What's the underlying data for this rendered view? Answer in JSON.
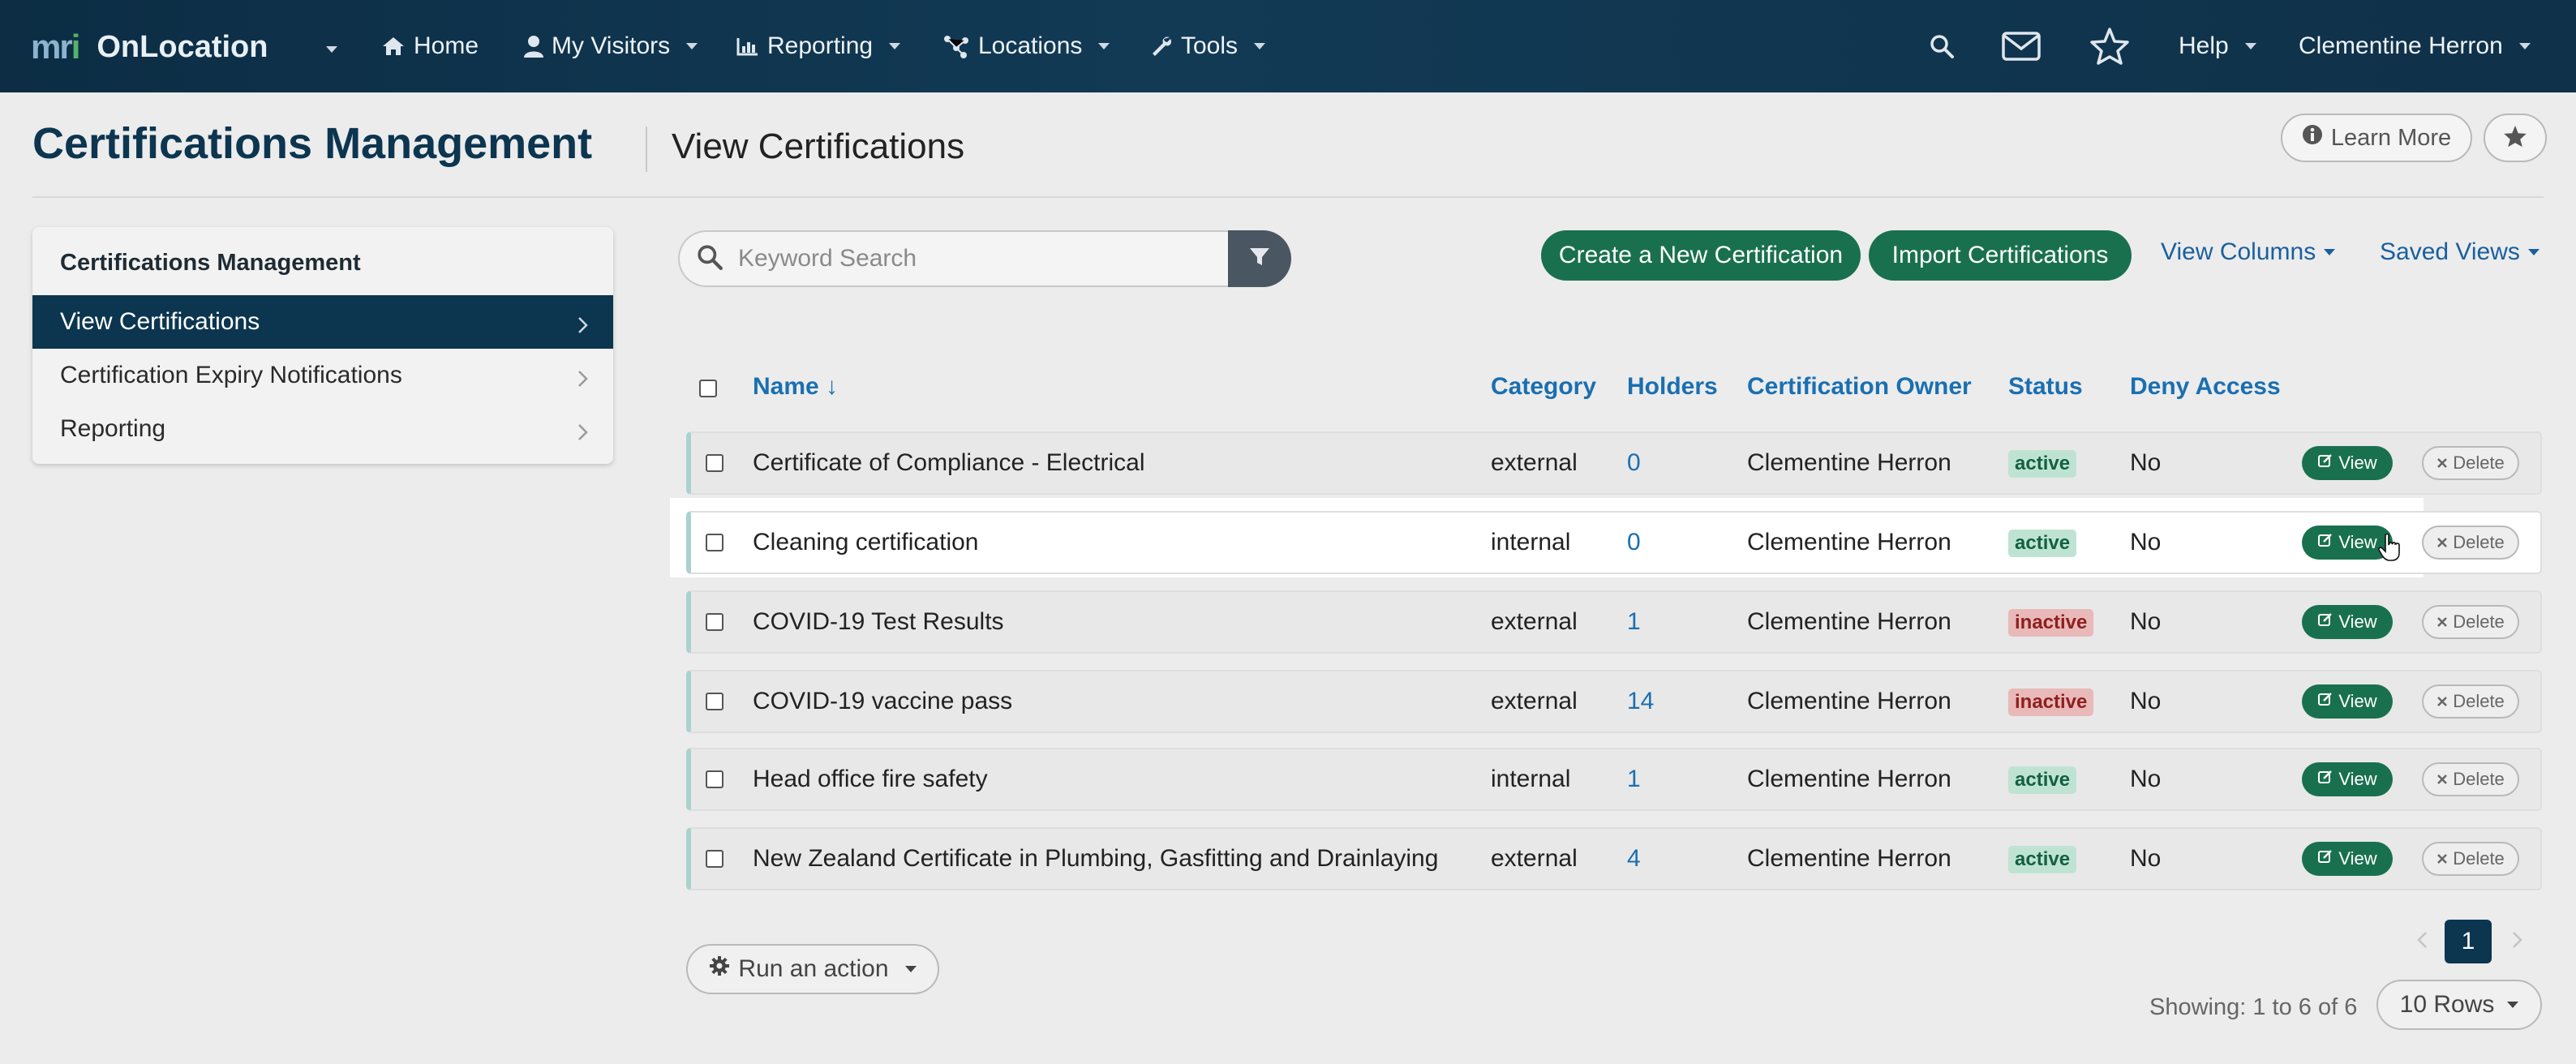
{
  "nav": {
    "logo_text": "mri",
    "brand": "OnLocation",
    "home": "Home",
    "my_visitors": "My Visitors",
    "reporting": "Reporting",
    "locations": "Locations",
    "tools": "Tools",
    "help": "Help",
    "user": "Clementine Herron"
  },
  "page": {
    "title": "Certifications Management",
    "subtitle": "View Certifications",
    "learn_more": "Learn More"
  },
  "sidebar": {
    "heading": "Certifications Management",
    "items": [
      {
        "label": "View Certifications",
        "active": true
      },
      {
        "label": "Certification Expiry Notifications",
        "active": false
      },
      {
        "label": "Reporting",
        "active": false
      }
    ]
  },
  "toolbar": {
    "search_placeholder": "Keyword Search",
    "create_label": "Create a New Certification",
    "import_label": "Import Certifications",
    "view_columns": "View Columns",
    "saved_views": "Saved Views"
  },
  "table": {
    "columns": {
      "name": "Name ↓",
      "category": "Category",
      "holders": "Holders",
      "owner": "Certification Owner",
      "status": "Status",
      "deny": "Deny Access"
    },
    "view_label": "View",
    "delete_label": "Delete",
    "rows": [
      {
        "name": "Certificate of Compliance - Electrical",
        "category": "external",
        "holders": "0",
        "owner": "Clementine Herron",
        "status": "active",
        "deny": "No"
      },
      {
        "name": "Cleaning certification",
        "category": "internal",
        "holders": "0",
        "owner": "Clementine Herron",
        "status": "active",
        "deny": "No"
      },
      {
        "name": "COVID-19 Test Results",
        "category": "external",
        "holders": "1",
        "owner": "Clementine Herron",
        "status": "inactive",
        "deny": "No"
      },
      {
        "name": "COVID-19 vaccine pass",
        "category": "external",
        "holders": "14",
        "owner": "Clementine Herron",
        "status": "inactive",
        "deny": "No"
      },
      {
        "name": "Head office fire safety",
        "category": "internal",
        "holders": "1",
        "owner": "Clementine Herron",
        "status": "active",
        "deny": "No"
      },
      {
        "name": "New Zealand Certificate in Plumbing, Gasfitting and Drainlaying",
        "category": "external",
        "holders": "4",
        "owner": "Clementine Herron",
        "status": "active",
        "deny": "No"
      }
    ]
  },
  "footer": {
    "run_action": "Run an action",
    "page_current": "1",
    "showing": "Showing: 1 to 6 of 6",
    "rows_per_page": "10 Rows"
  },
  "colors": {
    "nav_bg": "#0c2d44",
    "primary_green": "#19704f",
    "active_nav": "#0c3550",
    "link_blue": "#1a6fb1"
  }
}
